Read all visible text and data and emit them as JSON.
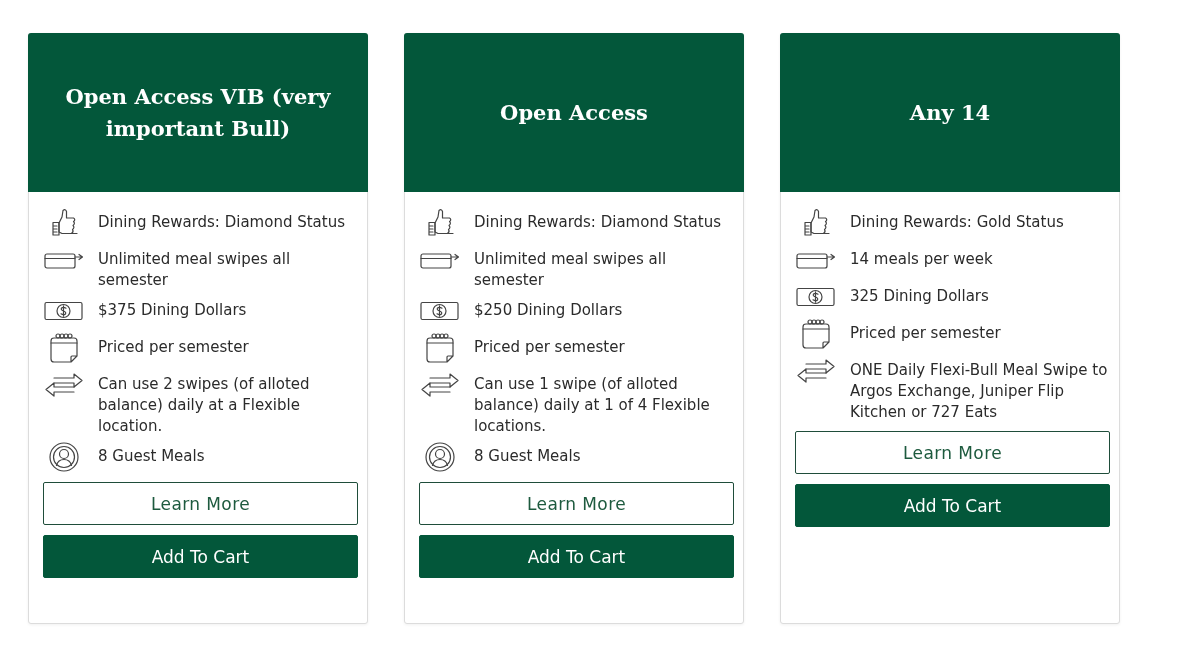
{
  "plans": [
    {
      "title": "Open Access VIB (very important Bull)",
      "features": [
        {
          "kind": "rewards",
          "text": "Dining Rewards: Diamond Status"
        },
        {
          "kind": "swipes",
          "text": "Unlimited meal swipes all semester"
        },
        {
          "kind": "dollars",
          "text": "$375 Dining Dollars"
        },
        {
          "kind": "pricing",
          "text": "Priced per semester"
        },
        {
          "kind": "flex",
          "text": "Can use 2 swipes (of alloted balance) daily at a Flexible location."
        },
        {
          "kind": "guests",
          "text": "8 Guest Meals"
        }
      ],
      "buttons": [
        {
          "kind": "outline",
          "label": "Learn More"
        },
        {
          "kind": "filled",
          "label": "Add To Cart"
        }
      ]
    },
    {
      "title": "Open Access",
      "features": [
        {
          "kind": "rewards",
          "text": "Dining Rewards: Diamond Status"
        },
        {
          "kind": "swipes",
          "text": "Unlimited meal swipes all semester"
        },
        {
          "kind": "dollars",
          "text": "$250 Dining Dollars"
        },
        {
          "kind": "pricing",
          "text": "Priced per semester"
        },
        {
          "kind": "flex",
          "text": "Can use 1 swipe (of alloted balance) daily at 1 of 4 Flexible locations."
        },
        {
          "kind": "guests",
          "text": "8 Guest Meals"
        }
      ],
      "buttons": [
        {
          "kind": "outline",
          "label": "Learn More"
        },
        {
          "kind": "filled",
          "label": "Add To Cart"
        }
      ]
    },
    {
      "title": "Any 14",
      "features": [
        {
          "kind": "rewards",
          "text": "Dining Rewards: Gold Status"
        },
        {
          "kind": "swipes",
          "text": "14 meals per week"
        },
        {
          "kind": "dollars",
          "text": "325 Dining Dollars"
        },
        {
          "kind": "pricing",
          "text": "Priced per semester"
        },
        {
          "kind": "flex",
          "text": "ONE Daily Flexi-Bull Meal Swipe to Argos Exchange, Juniper Flip Kitchen or 727 Eats"
        }
      ],
      "buttons": [
        {
          "kind": "outline",
          "label": "Learn More"
        },
        {
          "kind": "filled",
          "label": "Add To Cart"
        }
      ]
    }
  ]
}
